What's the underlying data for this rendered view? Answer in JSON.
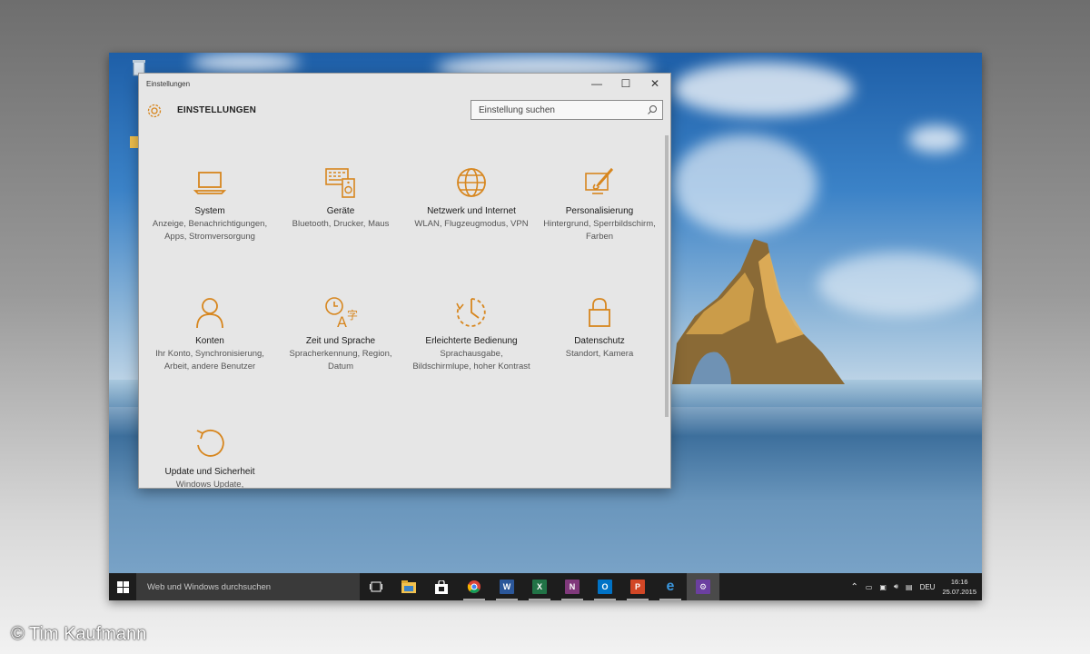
{
  "window": {
    "title": "Einstellungen",
    "minimize_symbol": "—",
    "maximize_symbol": "☐",
    "close_symbol": "✕"
  },
  "header": {
    "heading": "EINSTELLUNGEN",
    "search_placeholder": "Einstellung suchen"
  },
  "accent_color": "#d7861e",
  "categories": [
    {
      "icon": "laptop-icon",
      "name": "System",
      "desc": "Anzeige, Benachrichtigungen, Apps, Stromversorgung"
    },
    {
      "icon": "keyboard-speaker-icon",
      "name": "Geräte",
      "desc": "Bluetooth, Drucker, Maus"
    },
    {
      "icon": "globe-icon",
      "name": "Netzwerk und Internet",
      "desc": "WLAN, Flugzeugmodus, VPN"
    },
    {
      "icon": "paint-brush-icon",
      "name": "Personalisierung",
      "desc": "Hintergrund, Sperrbildschirm, Farben"
    },
    {
      "icon": "person-icon",
      "name": "Konten",
      "desc": "Ihr Konto, Synchronisierung, Arbeit, andere Benutzer"
    },
    {
      "icon": "clock-language-icon",
      "name": "Zeit und Sprache",
      "desc": "Spracherkennung, Region, Datum"
    },
    {
      "icon": "ease-of-access-icon",
      "name": "Erleichterte Bedienung",
      "desc": "Sprachausgabe, Bildschirmlupe, hoher Kontrast"
    },
    {
      "icon": "lock-icon",
      "name": "Datenschutz",
      "desc": "Standort, Kamera"
    },
    {
      "icon": "refresh-icon",
      "name": "Update und Sicherheit",
      "desc": "Windows Update,"
    }
  ],
  "taskbar": {
    "search_text": "Web und Windows durchsuchen",
    "apps": [
      {
        "icon": "task-view-icon",
        "letter": "",
        "color": "#1d1d1d"
      },
      {
        "icon": "file-explorer-icon",
        "letter": "",
        "color": "#f2c14e"
      },
      {
        "icon": "store-icon",
        "letter": "",
        "color": "#ffffff"
      },
      {
        "icon": "chrome-icon",
        "letter": "",
        "color": "#db4437"
      },
      {
        "icon": "word-icon",
        "letter": "W",
        "color": "#2b579a"
      },
      {
        "icon": "excel-icon",
        "letter": "X",
        "color": "#217346"
      },
      {
        "icon": "onenote-icon",
        "letter": "N",
        "color": "#80397b"
      },
      {
        "icon": "outlook-icon",
        "letter": "O",
        "color": "#0072c6"
      },
      {
        "icon": "powerpoint-icon",
        "letter": "P",
        "color": "#d24726"
      },
      {
        "icon": "edge-icon",
        "letter": "e",
        "color": "#1d1d1d"
      },
      {
        "icon": "settings-icon",
        "letter": "⚙",
        "color": "#6b3fa0"
      }
    ],
    "language": "DEU",
    "time": "16:16",
    "date": "25.07.2015"
  },
  "copyright": "© Tim Kaufmann"
}
